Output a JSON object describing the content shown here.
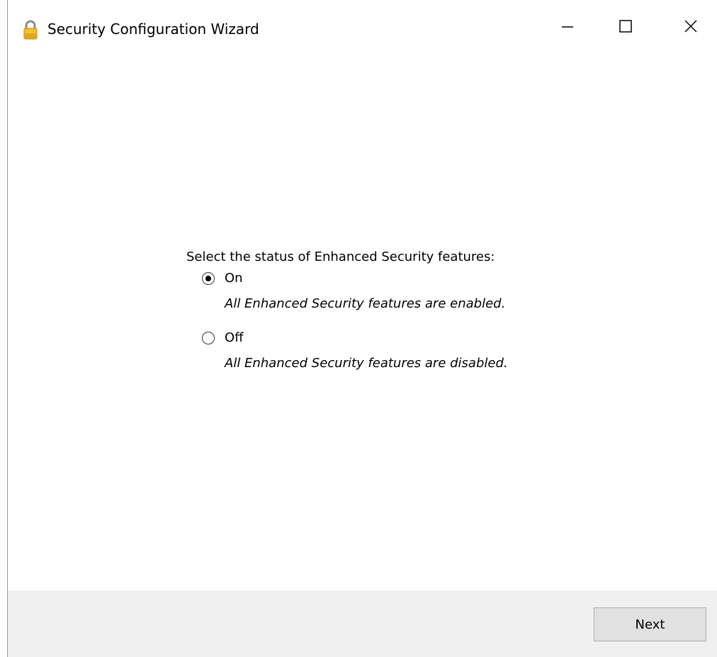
{
  "window": {
    "title": "Security Configuration Wizard",
    "icon": "lock-icon",
    "controls": {
      "minimize_icon": "minimize-icon",
      "maximize_icon": "maximize-icon",
      "close_icon": "close-icon"
    }
  },
  "main": {
    "prompt": "Select the status of Enhanced Security features:",
    "options": [
      {
        "label": "On",
        "description": "All Enhanced Security features are enabled.",
        "selected": true
      },
      {
        "label": "Off",
        "description": "All Enhanced Security features are disabled.",
        "selected": false
      }
    ]
  },
  "footer": {
    "next_label": "Next"
  },
  "colors": {
    "footer_bg": "#f0f0f0",
    "button_bg": "#e1e1e1",
    "button_border": "#adadad",
    "lock_body": "#f2c230",
    "lock_shackle": "#8c8c8c"
  }
}
